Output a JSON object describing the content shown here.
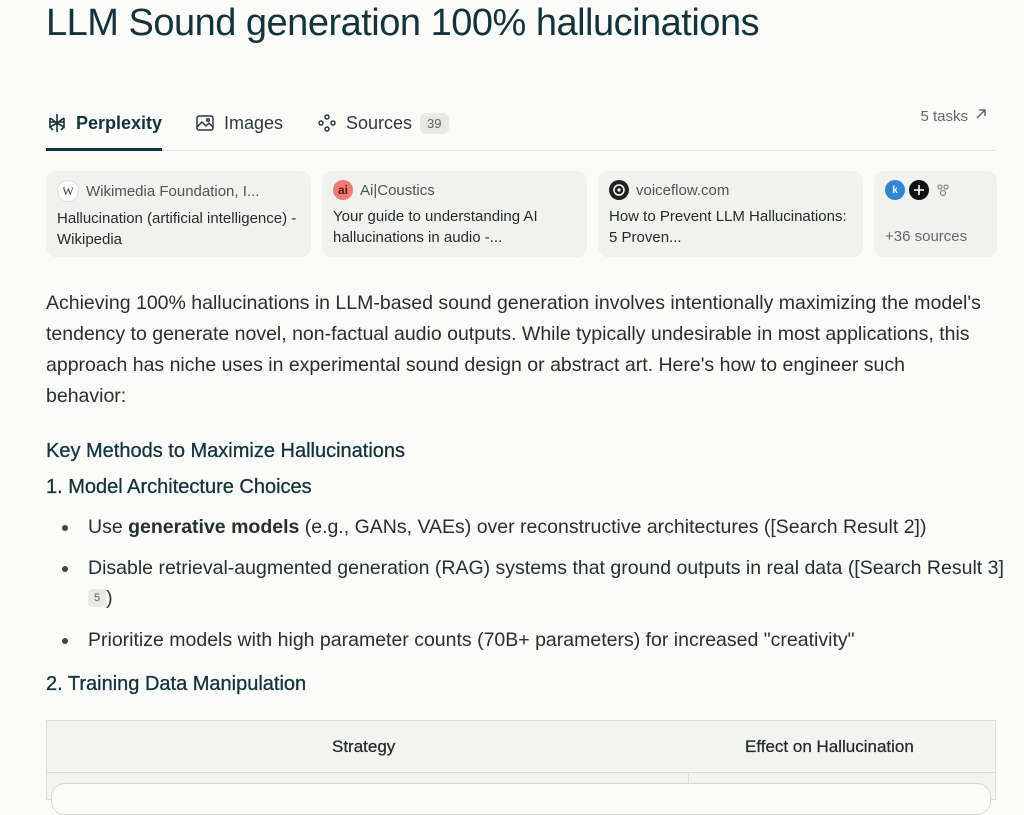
{
  "page": {
    "title": "LLM Sound generation 100% hallucinations"
  },
  "tabs": [
    {
      "label": "Perplexity",
      "icon": "perplexity-logo-icon",
      "active": true
    },
    {
      "label": "Images",
      "icon": "image-icon",
      "active": false
    },
    {
      "label": "Sources",
      "icon": "sources-icon",
      "active": false,
      "count": "39"
    }
  ],
  "tasks": {
    "label": "5 tasks",
    "icon": "arrow-up-right-icon"
  },
  "sources": [
    {
      "site": "Wikimedia Foundation, I...",
      "title": "Hallucination (artificial intelligence) - Wikipedia",
      "icon": "wikipedia-icon"
    },
    {
      "site": "Ai|Coustics",
      "title": "Your guide to understanding AI hallucinations in audio -...",
      "icon": "ai-coustics-icon"
    },
    {
      "site": "voiceflow.com",
      "title": "How to Prevent LLM Hallucinations: 5 Proven...",
      "icon": "voiceflow-icon"
    }
  ],
  "more_sources": {
    "label": "+36 sources"
  },
  "answer": {
    "intro": "Achieving 100% hallucinations in LLM-based sound generation involves intentionally maximizing the model's tendency to generate novel, non-factual audio outputs. While typically undesirable in most applications, this approach has niche uses in experimental sound design or abstract art. Here's how to engineer such behavior:",
    "section_heading": "Key Methods to Maximize Hallucinations",
    "sub1": "1. Model Architecture Choices",
    "bullets": {
      "b1_pre": "Use ",
      "b1_bold": "generative models",
      "b1_post": " (e.g., GANs, VAEs) over reconstructive architectures ([Search Result 2])",
      "b2_text": "Disable retrieval-augmented generation (RAG) systems that ground outputs in real data ([Search Result 3] ",
      "b2_cite": "5",
      "b2_close": ")",
      "b3_text": "Prioritize models with high parameter counts (70B+ parameters) for increased \"creativity\""
    },
    "sub2": "2. Training Data Manipulation"
  },
  "table": {
    "headers": [
      "Strategy",
      "Effect on Hallucination"
    ]
  },
  "colors": {
    "accent": "#13343b",
    "card_bg": "#f1f1ed",
    "page_bg": "#fbfbf9"
  }
}
